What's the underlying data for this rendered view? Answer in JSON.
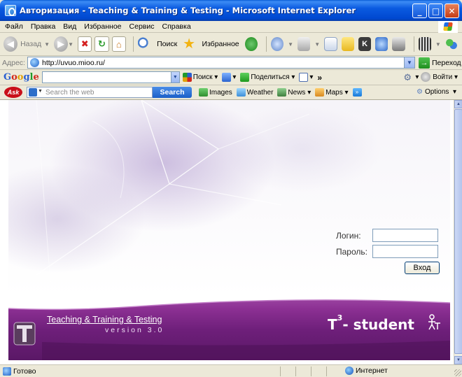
{
  "window": {
    "title": "Авторизация - Teaching & Training & Testing - Microsoft Internet Explorer",
    "minimize": "_",
    "maximize": "□",
    "close": "✕"
  },
  "menu": {
    "items": [
      "Файл",
      "Правка",
      "Вид",
      "Избранное",
      "Сервис",
      "Справка"
    ]
  },
  "toolbar": {
    "back_label": "Назад",
    "search_label": "Поиск",
    "favorites_label": "Избранное"
  },
  "address": {
    "label": "Адрес:",
    "url": "http://uvuo.mioo.ru/",
    "go_label": "Переход"
  },
  "google": {
    "search_label": "Поиск",
    "share_label": "Поделиться",
    "more": "»",
    "signin_label": "Войти"
  },
  "ask": {
    "logo": "Ask",
    "placeholder": "Search the web",
    "search_button": "Search",
    "images": "Images",
    "weather": "Weather",
    "news": "News",
    "maps": "Maps",
    "options": "Options"
  },
  "page": {
    "login_label": "Логин:",
    "password_label": "Пароль:",
    "login_value": "",
    "password_value": "",
    "submit_label": "Вход",
    "brand_title": "Teaching & Training & Testing",
    "brand_version": "version 3.0",
    "product_t": "T",
    "product_sup": "3",
    "product_rest": "- student"
  },
  "status": {
    "text": "Готово",
    "zone": "Интернет"
  },
  "colors": {
    "title_bar": "#0a5ae0",
    "brand_purple": "#8b2f92",
    "window_chrome": "#ece9d8"
  }
}
